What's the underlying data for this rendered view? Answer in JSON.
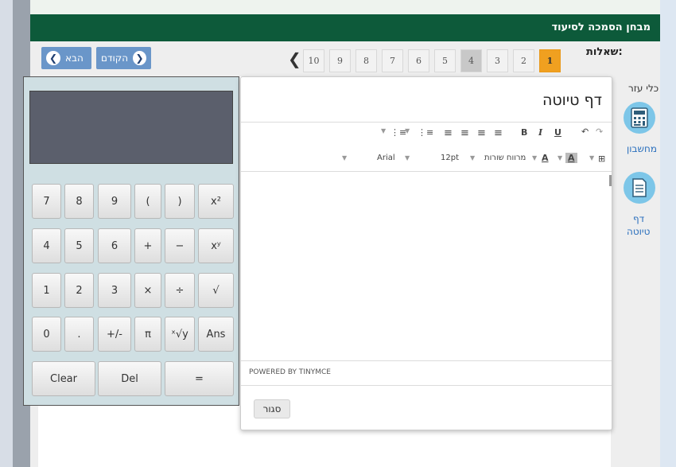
{
  "header": {
    "title": "מבחן הסמכה לסיעוד"
  },
  "nav": {
    "next_label": "הבא",
    "prev_label": "הקודם",
    "next_arrow": "❮",
    "prev_arrow": "❯"
  },
  "pager": {
    "arrow": "❮",
    "label": "שאלות:",
    "pages": [
      "10",
      "9",
      "8",
      "7",
      "6",
      "5",
      "4",
      "3",
      "2",
      "1"
    ],
    "visited": "4",
    "current": "1"
  },
  "tools": {
    "label": "כלי עזר",
    "calculator_label": "מחשבון",
    "scratchpad_label_line1": "דף",
    "scratchpad_label_line2": "טיוטה"
  },
  "calculator": {
    "keys": [
      [
        "7",
        "8",
        "9",
        "(",
        ")",
        "x²"
      ],
      [
        "4",
        "5",
        "6",
        "+",
        "−",
        "xʸ"
      ],
      [
        "1",
        "2",
        "3",
        "×",
        "÷",
        "√"
      ],
      [
        "0",
        ".",
        "+/-",
        "π",
        "ˣ√y",
        "Ans"
      ],
      [
        "Clear",
        "Del",
        "="
      ]
    ]
  },
  "scratchpad": {
    "title": "דף טיוטה",
    "font_name": "Arial",
    "font_size": "12pt",
    "line_height_label": "מרווח שורות",
    "bold": "B",
    "italic": "I",
    "underline": "U",
    "text_color": "A",
    "bg_color": "A",
    "footer": "POWERED BY TINYMCE",
    "close_label": "סגור"
  },
  "colors": {
    "header": "#0d5a3a",
    "nav_button": "#6a96c9",
    "current_page": "#f0a020",
    "tool_icon": "#7dc6e8"
  }
}
